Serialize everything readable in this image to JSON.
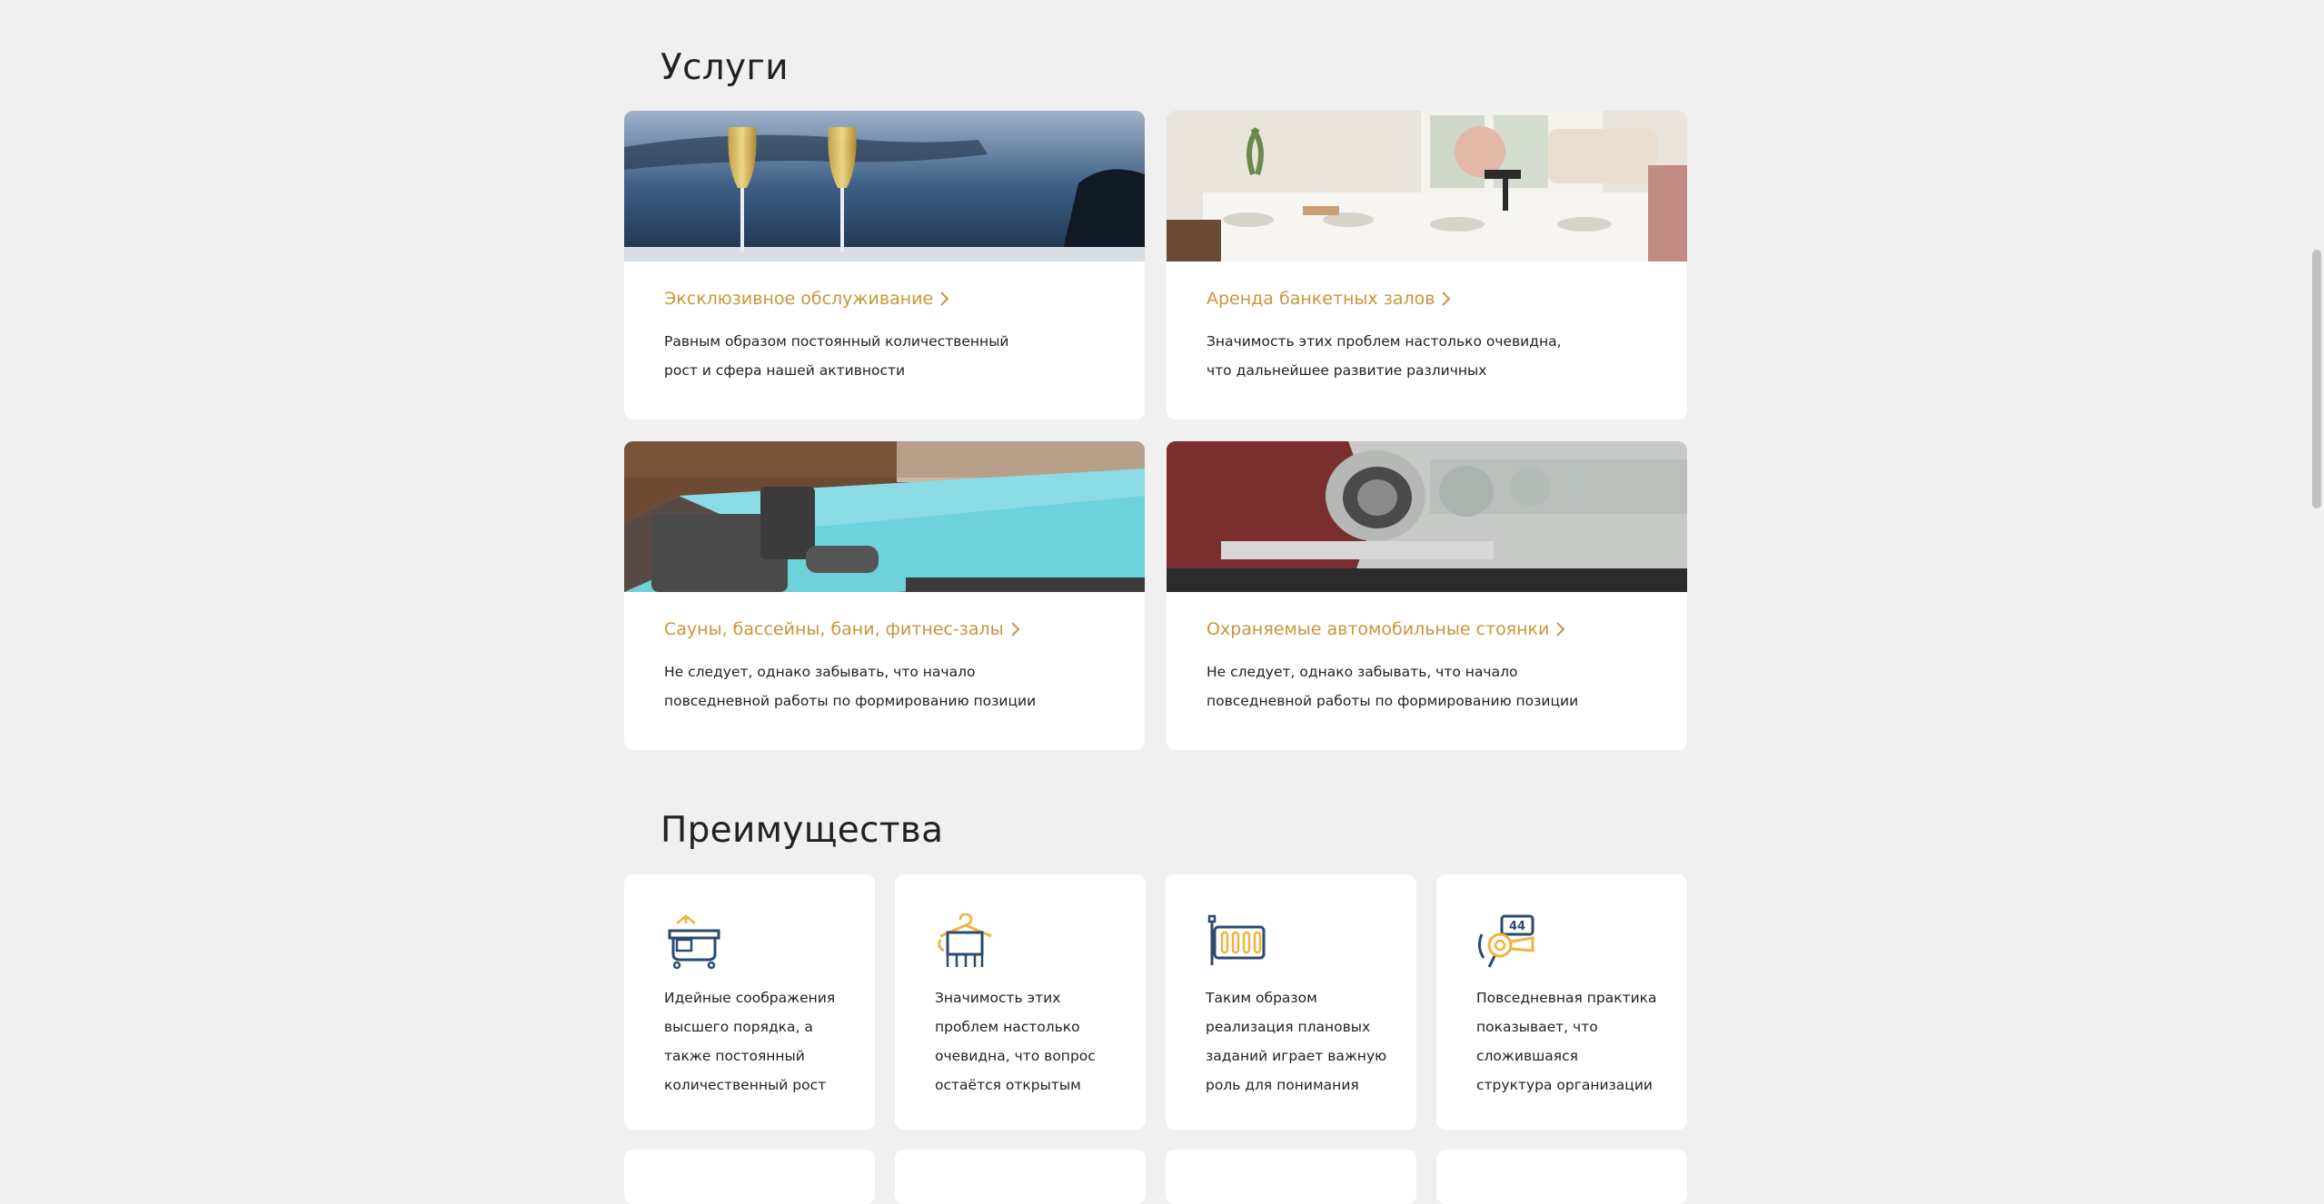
{
  "services": {
    "title": "Услуги",
    "cards": [
      {
        "title": "Эксклюзивное обслуживание",
        "desc": "Равным образом постоянный количественный рост и сфера нашей активности",
        "image": "champagne-glasses"
      },
      {
        "title": "Аренда банкетных залов",
        "desc": "Значимость этих проблем настолько очевидна, что дальнейшее развитие различных",
        "image": "banquet-hall"
      },
      {
        "title": "Сауны, бассейны, бани, фитнес-залы",
        "desc": "Не следует, однако забывать, что начало повседневной работы по формированию позиции",
        "image": "pool"
      },
      {
        "title": "Охраняемые автомобильные стоянки",
        "desc": "Не следует, однако забывать, что начало повседневной работы по формированию позиции",
        "image": "vintage-cars"
      }
    ]
  },
  "advantages": {
    "title": "Преимущества",
    "items": [
      {
        "icon": "bathtub-icon",
        "text": "Идейные соображения высшего порядка, а также постоянный количественный рост"
      },
      {
        "icon": "towel-hanger-icon",
        "text": "Значимость этих проблем настолько очевидна, что вопрос остаётся открытым"
      },
      {
        "icon": "radiator-icon",
        "text": "Таким образом реализация плановых заданий играет важную роль для понимания"
      },
      {
        "icon": "hairdryer-icon",
        "text": "Повседневная практика показывает, что сложившаяся структура организации"
      }
    ]
  },
  "colors": {
    "accent": "#c9963c",
    "icon_blue": "#2c4a6e",
    "icon_yellow": "#f0b43c",
    "background": "#f0f0f0"
  }
}
